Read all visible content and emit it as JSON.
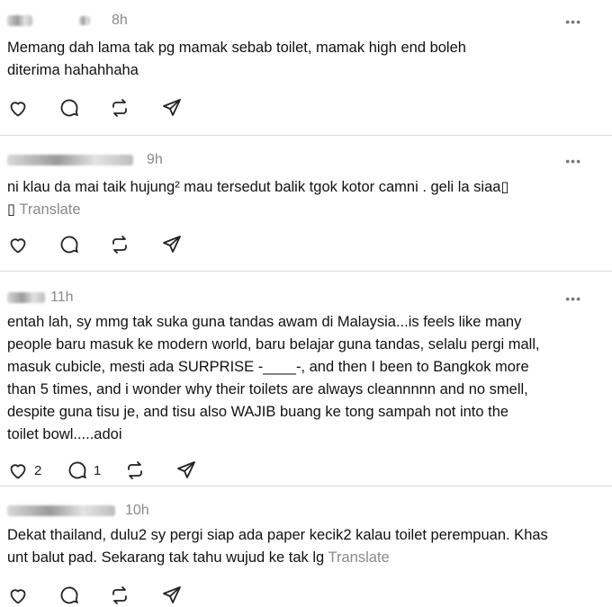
{
  "posts": [
    {
      "author_visible": "ˢ⁾ˡ ˡ",
      "time": "8h",
      "more": "•••",
      "text_lines": [
        "Memang dah lama tak pg mamak sebab toilet, mamak high end boleh",
        "diterima hahahhaha"
      ],
      "translate": "",
      "likes": "",
      "replies": ""
    },
    {
      "author_visible": "...",
      "time": "9h",
      "more": "•••",
      "text_lines": [
        "ni klau da mai taik hujung² mau tersedut balik tgok kotor camni . geli la siaa▯",
        "▯ "
      ],
      "translate": "Translate",
      "likes": "",
      "replies": ""
    },
    {
      "author_visible": "",
      "time": "11h",
      "more": "•••",
      "text_lines": [
        "entah lah, sy mmg tak suka guna tandas awam di Malaysia...is feels like many",
        "people baru masuk ke modern world, baru belajar guna tandas, selalu pergi mall,",
        "masuk cubicle, mesti ada SURPRISE -____-, and then I been to Bangkok more",
        "than 5 times, and i wonder why their toilets are always cleannnnn and no smell,",
        "despite guna tisu je, and tisu also WAJIB buang ke tong sampah not into the",
        "toilet bowl.....adoi"
      ],
      "translate": "",
      "likes": "2",
      "replies": "1"
    },
    {
      "author_visible": "",
      "time": "10h",
      "more": "",
      "text_lines": [
        "Dekat thailand, dulu2 sy pergi siap ada paper kecik2 kalau toilet perempuan. Khas",
        "unt balut pad. Sekarang tak tahu wujud ke tak lg  "
      ],
      "translate": "Translate",
      "likes": "",
      "replies": ""
    }
  ],
  "icons": [
    "heart-icon",
    "comment-icon",
    "repost-icon",
    "share-icon",
    "more-icon"
  ]
}
